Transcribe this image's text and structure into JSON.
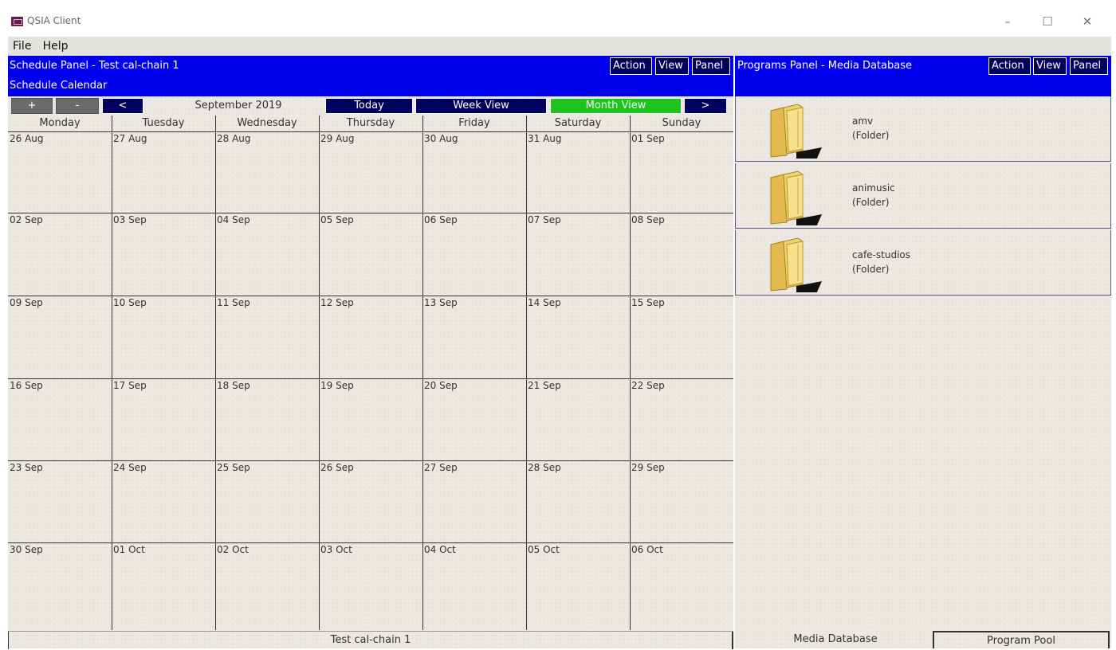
{
  "window": {
    "title": "QSIA Client",
    "minimize": "–",
    "maximize": "☐",
    "close": "✕"
  },
  "menu": [
    "File",
    "Help"
  ],
  "schedule": {
    "header_title": "Schedule Panel - Test cal-chain 1",
    "subheader": "Schedule Calendar",
    "buttons": {
      "action": "Action",
      "view": "View",
      "panel": "Panel"
    },
    "nav": {
      "plus": "+",
      "minus": "-",
      "prev": "<",
      "month": "September 2019",
      "today": "Today",
      "week_view": "Week View",
      "month_view": "Month View",
      "next": ">"
    },
    "days": [
      "Monday",
      "Tuesday",
      "Wednesday",
      "Thursday",
      "Friday",
      "Saturday",
      "Sunday"
    ],
    "weeks": [
      [
        "26 Aug",
        "27 Aug",
        "28 Aug",
        "29 Aug",
        "30 Aug",
        "31 Aug",
        "01 Sep"
      ],
      [
        "02 Sep",
        "03 Sep",
        "04 Sep",
        "05 Sep",
        "06 Sep",
        "07 Sep",
        "08 Sep"
      ],
      [
        "09 Sep",
        "10 Sep",
        "11 Sep",
        "12 Sep",
        "13 Sep",
        "14 Sep",
        "15 Sep"
      ],
      [
        "16 Sep",
        "17 Sep",
        "18 Sep",
        "19 Sep",
        "20 Sep",
        "21 Sep",
        "22 Sep"
      ],
      [
        "23 Sep",
        "24 Sep",
        "25 Sep",
        "26 Sep",
        "27 Sep",
        "28 Sep",
        "29 Sep"
      ],
      [
        "30 Sep",
        "01 Oct",
        "02 Oct",
        "03 Oct",
        "04 Oct",
        "05 Oct",
        "06 Oct"
      ]
    ],
    "status": "Test cal-chain 1"
  },
  "programs": {
    "header_title": "Programs Panel - Media Database",
    "buttons": {
      "action": "Action",
      "view": "View",
      "panel": "Panel"
    },
    "folders": [
      {
        "name": "amv",
        "type": "(Folder)"
      },
      {
        "name": "animusic",
        "type": "(Folder)"
      },
      {
        "name": "cafe-studios",
        "type": "(Folder)"
      }
    ],
    "tabs": [
      "Media Database",
      "Program Pool"
    ]
  },
  "colors": {
    "header_blue": "#0000ee",
    "button_navy": "#00005e",
    "active_green": "#1ec31e",
    "folder_yellow": "#f2d36b"
  }
}
